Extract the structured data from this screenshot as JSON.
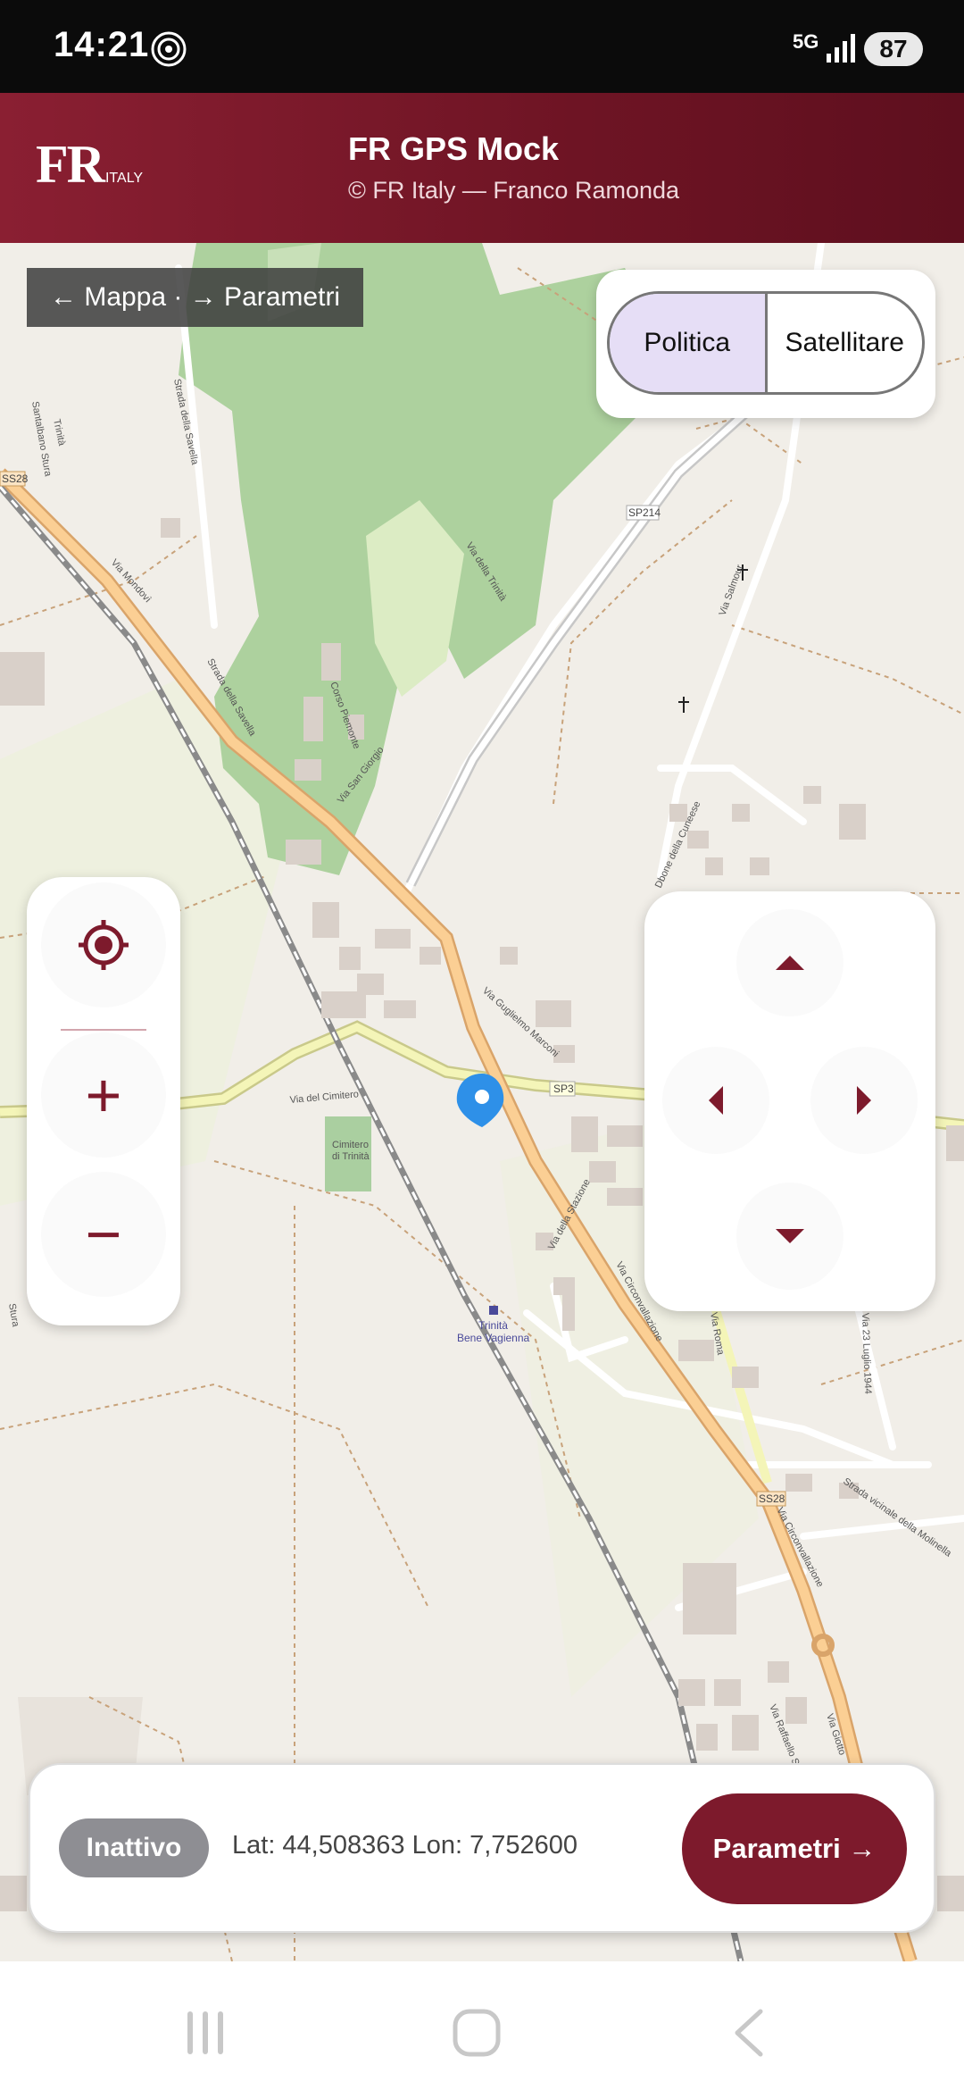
{
  "status_bar": {
    "time": "14:21",
    "network": "5G",
    "battery": "87"
  },
  "header": {
    "logo_main": "FR",
    "logo_sub": "ITALY",
    "title": "FR GPS Mock",
    "subtitle": "© FR Italy — Franco Ramonda"
  },
  "map": {
    "hint": "← Mappa · → Parametri",
    "layer_toggle": {
      "options": [
        "Politica",
        "Satellitare"
      ],
      "selected": "Politica"
    },
    "labels": [
      "SS28",
      "SP214",
      "Via Mondovì",
      "Strada della Savella",
      "Corso Piemonte",
      "Via San Giorgio",
      "Via della Trinità",
      "Via Salmour",
      "Via del Cimitero",
      "Cimitero di Trinità",
      "Via Guglielmo Marconi",
      "SP3",
      "Via della Stazione",
      "Via Circonvallazione",
      "Trinità Bene Vagienna",
      "Via Roma",
      "Via 23 Luglio 1944",
      "Strada vicinale della Molinella",
      "Via Raffaello Sanzio",
      "Via Giotto",
      "Santalbano Stura",
      "Trinità"
    ]
  },
  "controls": {
    "locate": "crosshair-icon",
    "zoom_in": "+",
    "zoom_out": "−"
  },
  "bottom_bar": {
    "status": "Inattivo",
    "coords": "Lat: 44,508363 Lon: 7,752600",
    "button": "Parametri →"
  },
  "colors": {
    "accent": "#7d1a2c",
    "header_start": "#8a1f32",
    "status_inactive": "#8e8e93",
    "toggle_selected": "#e6def6"
  }
}
